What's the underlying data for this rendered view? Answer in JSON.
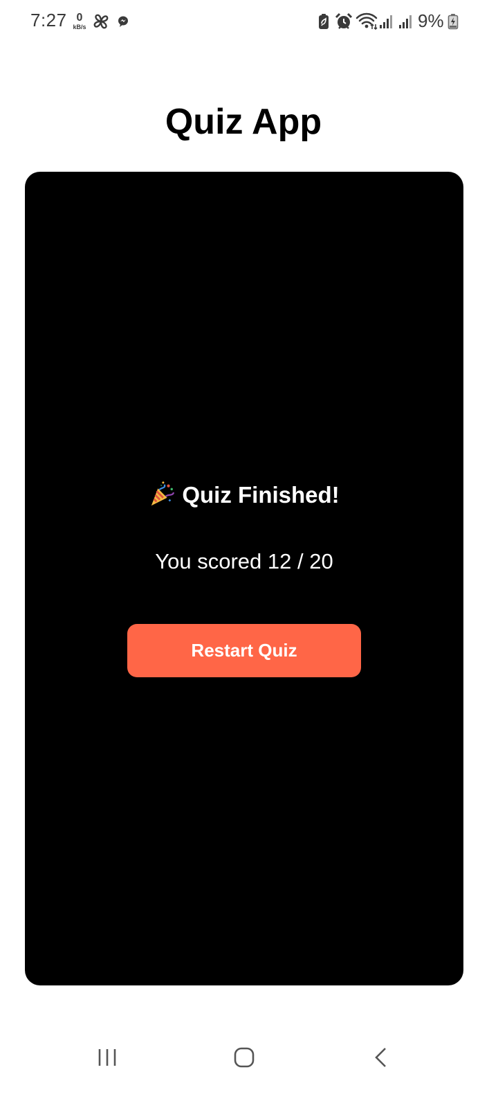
{
  "status_bar": {
    "time": "7:27",
    "network_speed_value": "0",
    "network_speed_unit": "kB/s",
    "battery_percent": "9%",
    "icons": [
      "pinwheel-icon",
      "messenger-icon",
      "battery-saver-icon",
      "alarm-icon",
      "wifi-icon",
      "signal-icon",
      "signal-icon",
      "battery-charging-icon"
    ]
  },
  "app": {
    "title": "Quiz App"
  },
  "result": {
    "heading": "Quiz Finished!",
    "heading_icon": "party-popper-icon",
    "score_text": "You scored 12 / 20",
    "restart_label": "Restart Quiz"
  },
  "nav_bar": {
    "icons": [
      "recent-apps-icon",
      "home-icon",
      "back-icon"
    ]
  },
  "colors": {
    "card_background": "#000000",
    "accent_button": "#ff6647",
    "page_background": "#ffffff"
  }
}
